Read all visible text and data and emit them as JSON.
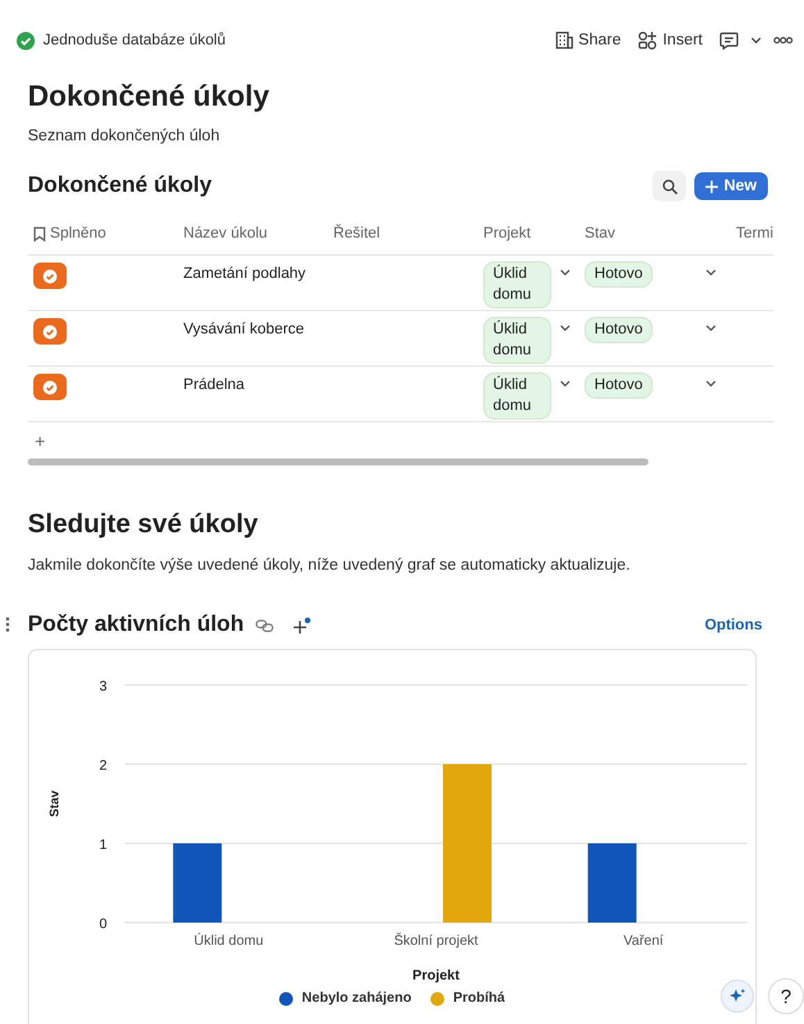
{
  "topbar": {
    "complete": true,
    "title": "Jednoduše databáze úkolů",
    "actions": [
      {
        "kind": "share",
        "label": "Share"
      },
      {
        "kind": "insert",
        "label": "Insert"
      },
      {
        "kind": "comment"
      },
      {
        "kind": "caret"
      },
      {
        "kind": "more"
      }
    ]
  },
  "page": {
    "title": "Dokončené úkoly",
    "subtitle": "Seznam dokončených úloh"
  },
  "table": {
    "title": "Dokončené úkoly",
    "new_button": "New",
    "columns": [
      "Splněno",
      "Název úkolu",
      "Řešitel",
      "Projekt",
      "Stav",
      "Termi"
    ],
    "rows": [
      {
        "done": true,
        "name": "Zametání podlahy",
        "project": "Úklid domu",
        "status": "Hotovo"
      },
      {
        "done": true,
        "name": "Vysávání koberce",
        "project": "Úklid domu",
        "status": "Hotovo"
      },
      {
        "done": true,
        "name": "Prádelna",
        "project": "Úklid domu",
        "status": "Hotovo"
      }
    ],
    "add_row": "+"
  },
  "section": {
    "title": "Sledujte své úkoly",
    "text": "Jakmile dokončíte výše uvedené úkoly, níže uvedený graf se automaticky aktualizuje."
  },
  "chart_block": {
    "title": "Počty aktivních úloh",
    "options": "Options",
    "chart_data": {
      "type": "bar",
      "xlabel": "Projekt",
      "ylabel": "Stav",
      "categories": [
        "Úklid domu",
        "Školní projekt",
        "Vaření"
      ],
      "series": [
        {
          "name": "Nebylo zahájeno",
          "color": "#1155bb",
          "values": [
            1,
            null,
            1
          ]
        },
        {
          "name": "Probíhá",
          "color": "#e1a70c",
          "values": [
            null,
            2,
            null
          ]
        }
      ],
      "ylim": [
        0,
        3
      ],
      "yticks": [
        0,
        1,
        2,
        3
      ],
      "legend": "bottom"
    }
  },
  "help": "?"
}
